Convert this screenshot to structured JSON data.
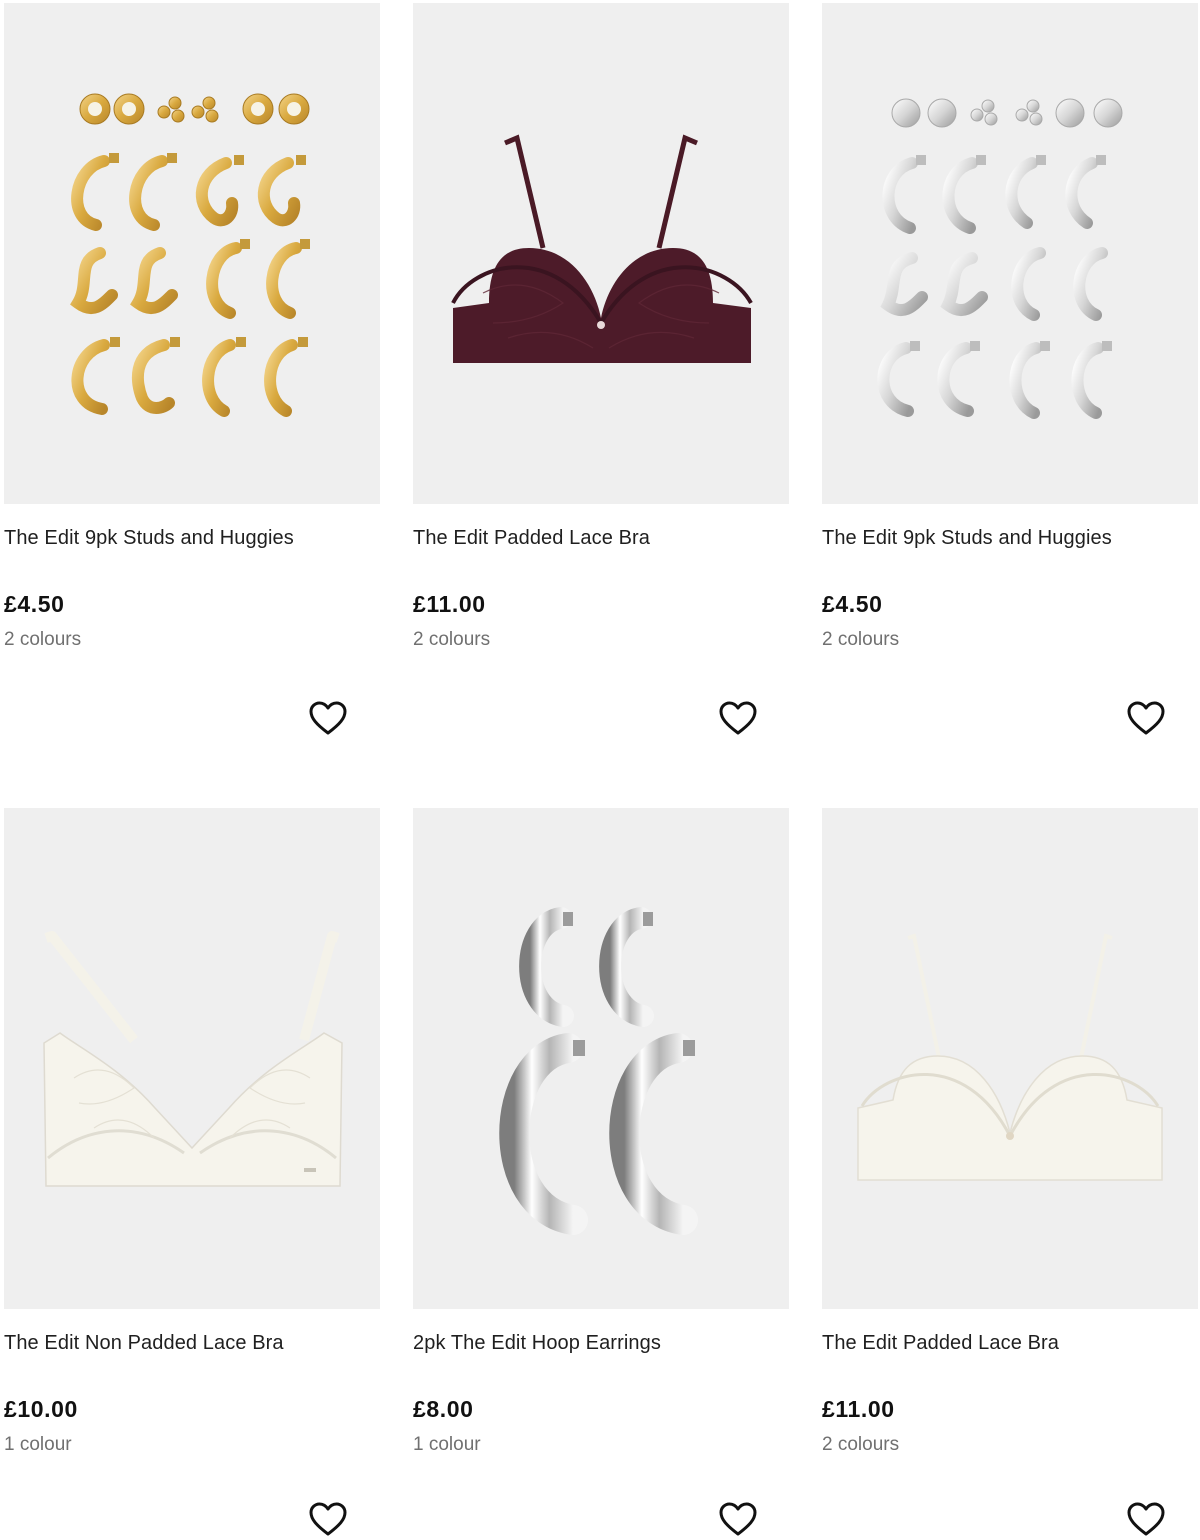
{
  "products": [
    {
      "title": "The Edit 9pk Studs and Huggies",
      "price": "£4.50",
      "colours": "2 colours",
      "image": "gold-earrings-set"
    },
    {
      "title": "The Edit Padded Lace Bra",
      "price": "£11.00",
      "colours": "2 colours",
      "image": "burgundy-padded-bra"
    },
    {
      "title": "The Edit 9pk Studs and Huggies",
      "price": "£4.50",
      "colours": "2 colours",
      "image": "silver-earrings-set"
    },
    {
      "title": "The Edit Non Padded Lace Bra",
      "price": "£10.00",
      "colours": "1 colour",
      "image": "ivory-lace-bra"
    },
    {
      "title": "2pk The Edit Hoop Earrings",
      "price": "£8.00",
      "colours": "1 colour",
      "image": "silver-hoop-earrings"
    },
    {
      "title": "The Edit Padded Lace Bra",
      "price": "£11.00",
      "colours": "2 colours",
      "image": "ivory-padded-bra"
    }
  ],
  "icons": {
    "wishlist": "heart-outline-icon"
  },
  "colors": {
    "image_bg": "#efefef",
    "price_text": "#111111",
    "colours_text": "#707070"
  }
}
